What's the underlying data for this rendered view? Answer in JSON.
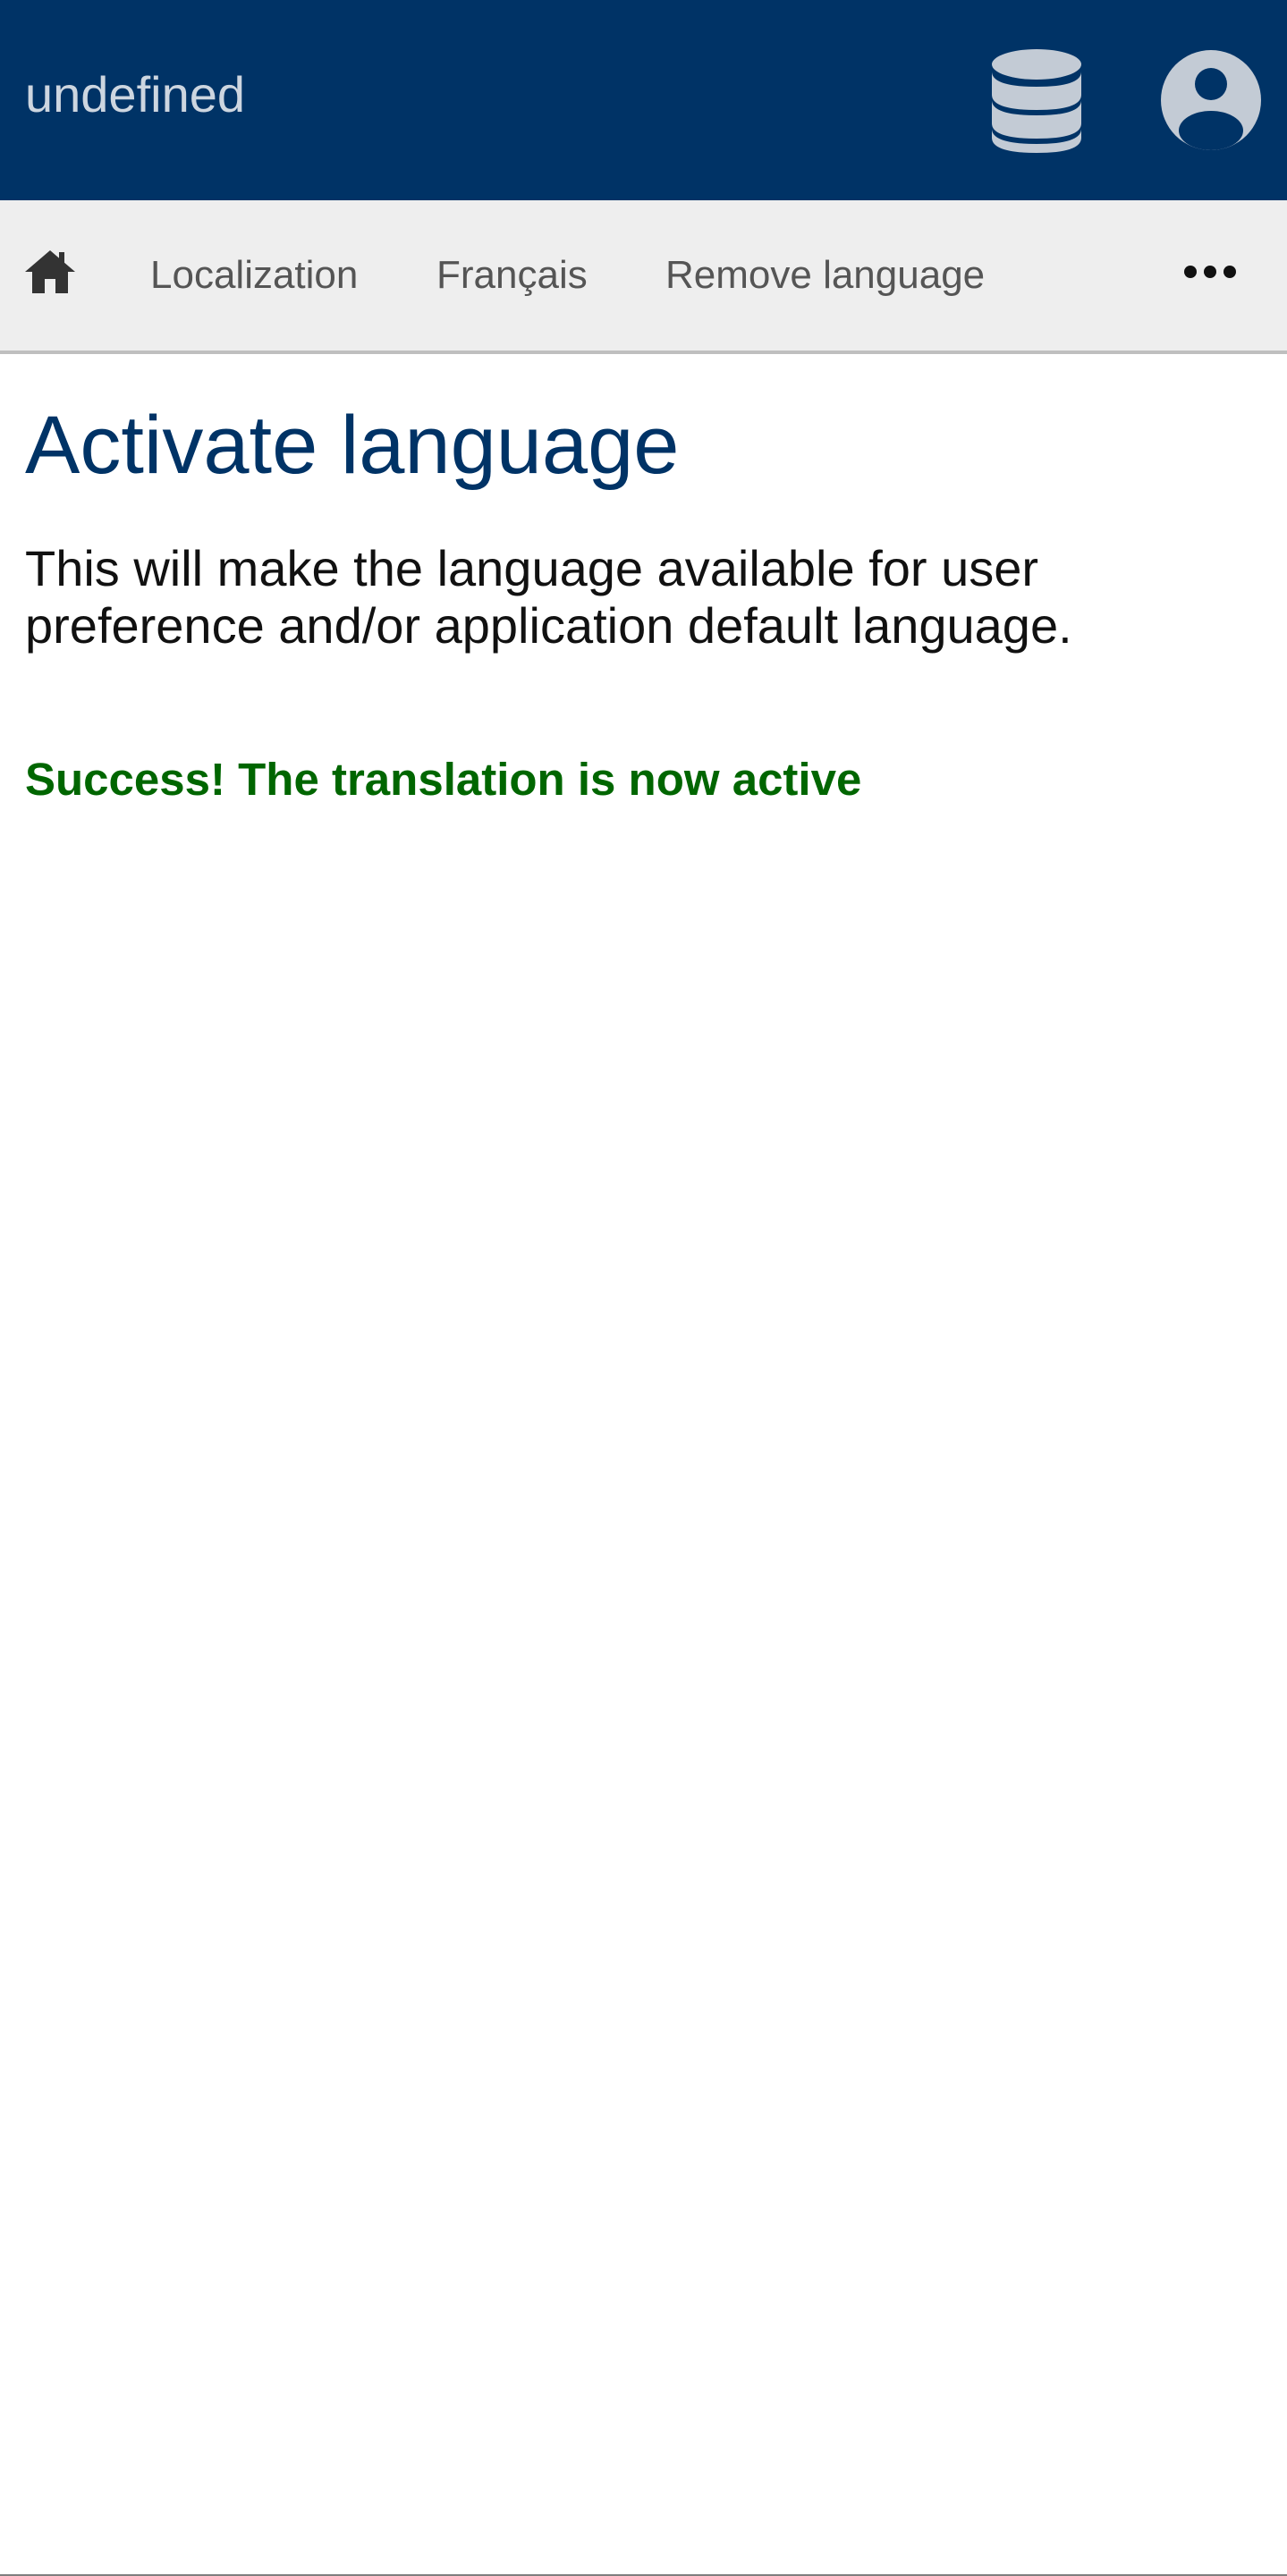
{
  "header": {
    "title": "undefined",
    "database_icon": "database-icon",
    "account_icon": "user-circle-icon",
    "background_color": "#003366"
  },
  "navbar": {
    "home_icon": "home-icon",
    "links": [
      {
        "label": "Localization"
      },
      {
        "label": "Français"
      },
      {
        "label": "Remove language"
      }
    ],
    "more_icon": "ellipsis-icon"
  },
  "main": {
    "title": "Activate language",
    "description": "This will make the language available for user preference and/or application default language.",
    "status_message": "Success! The translation is now active",
    "status_color": "#006600"
  }
}
